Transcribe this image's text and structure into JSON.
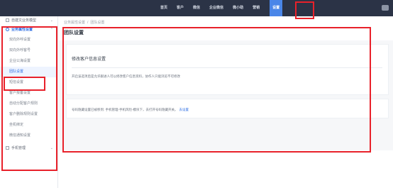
{
  "topnav": {
    "items": [
      "首页",
      "客户",
      "微信",
      "企业微信",
      "微小助",
      "营销",
      "设置"
    ],
    "active_index": 6
  },
  "sidebar": {
    "groups": [
      {
        "label": "自建文业务模型",
        "expanded": false
      },
      {
        "label": "业务属性设置",
        "expanded": true
      }
    ],
    "items": [
      "双向外呼设置",
      "双向外呼客号",
      "企业公海设置",
      "团队设置",
      "短信设置",
      "客户报备设置",
      "自动分配客户规则",
      "客户删除规则设置",
      "坐机绑定",
      "微信通知设置"
    ],
    "selected_index": 3,
    "bottom_group": {
      "label": "手机管理",
      "expanded": false
    }
  },
  "breadcrumb": [
    "业务属性设置",
    "/",
    "团队设置"
  ],
  "page": {
    "title": "团队设置",
    "card1": {
      "title": "修改客户信息设置",
      "text": "开启该选项后是允许跟进人可以修改客户信息资料，协作人只能浏览不可修改"
    },
    "card2": {
      "text": "号码隐藏设置已被移到: 手机管理-手机风险-模块下，去打开号码隐藏开关。",
      "link": "去设置"
    }
  },
  "colors": {
    "topbar_bg": "#2b3346",
    "accent": "#2f6fe4",
    "highlight": "#e8212a"
  }
}
